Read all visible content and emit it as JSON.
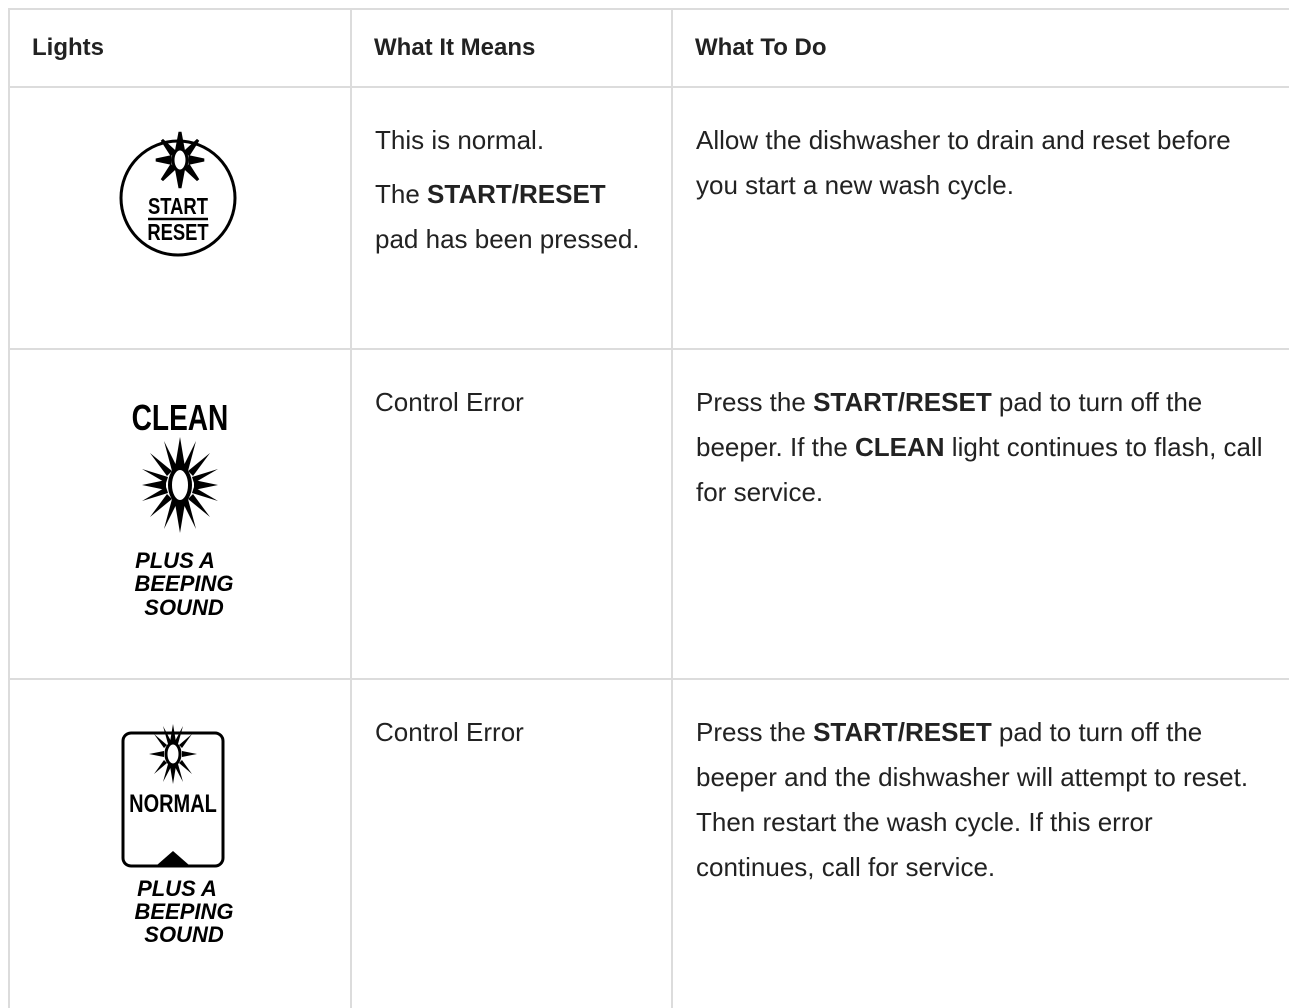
{
  "table": {
    "headers": {
      "lights": "Lights",
      "meaning": "What It Means",
      "todo": "What To Do"
    },
    "rows": [
      {
        "icon": {
          "name": "start-reset-flashing-light-icon",
          "line1": "START",
          "line2": "RESET"
        },
        "meaning": {
          "p1": "This is normal.",
          "p2_pre": "The ",
          "p2_bold": "START/RESET",
          "p2_post": " pad has been pressed."
        },
        "todo": {
          "text": "Allow the dishwasher to drain and reset before you start a new wash cycle."
        }
      },
      {
        "icon": {
          "name": "clean-flashing-light-icon",
          "label": "CLEAN",
          "caption1": "PLUS A",
          "caption2": "BEEPING",
          "caption3": "SOUND"
        },
        "meaning": {
          "p1": "Control Error"
        },
        "todo": {
          "t1": "Press the ",
          "b1": "START/RESET",
          "t2": " pad to turn off the beeper. If the ",
          "b2": "CLEAN",
          "t3": " light continues to flash, call for service."
        }
      },
      {
        "icon": {
          "name": "normal-flashing-light-icon",
          "label": "NORMAL",
          "caption1": "PLUS A",
          "caption2": "BEEPING",
          "caption3": "SOUND"
        },
        "meaning": {
          "p1": "Control Error"
        },
        "todo": {
          "t1": "Press the ",
          "b1": "START/RESET",
          "t2": " pad to turn off the beeper and the dishwasher will attempt to reset. Then restart the wash cycle. If this error continues, call for service."
        }
      }
    ]
  }
}
